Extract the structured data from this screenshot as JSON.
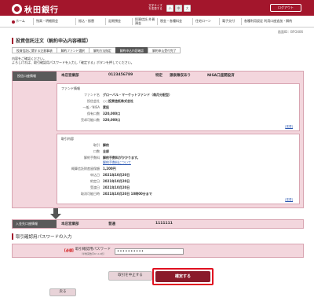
{
  "header": {
    "bank_name": "秋田銀行",
    "textsize_label": "文字サイズを変更する",
    "size_small": "小",
    "size_medium": "中",
    "size_large": "大",
    "logout": "ログアウト"
  },
  "nav": {
    "items": [
      "ホーム",
      "残高・明細照会",
      "振込・振替",
      "定期預金",
      "投資信託 外貨預金",
      "税金・各種料金",
      "住宅ローン",
      "電子交付",
      "各種利用設定 利用口座追加・解約"
    ]
  },
  "screen_id": "画面ID：BFO406",
  "page_title": "投資信託注文（解約申込内容確認）",
  "steps": [
    "投資信託に関する注意事項",
    "解約ファンド選択",
    "解約方法指定",
    "解約申込内容確認",
    "解約申込受付完了"
  ],
  "instructions": [
    "内容をご確認ください。",
    "よろしければ、取引確認用パスワードを入力し「確定する」ボタンを押してください。"
  ],
  "source_account": {
    "label": "投信口座情報",
    "branch": "本店営業部",
    "number": "0123456789",
    "type": "特定",
    "tax": "源泉徴収あり",
    "nisa": "NISA口座開設済"
  },
  "fund": {
    "section": "ファンド情報",
    "rows": [
      {
        "k": "ファンド名",
        "v": "グローバル・マーケットファンド（毎月分配型）"
      },
      {
        "k": "投信会社",
        "v": "○○投資信託株式会社"
      },
      {
        "k": "一般／NISA",
        "v": "累投"
      },
      {
        "k": "保有口数",
        "v": "320,000口"
      },
      {
        "k": "売却可能口数",
        "v": "320,000口"
      }
    ],
    "change": "[変更]"
  },
  "trade": {
    "section": "取引内容",
    "rows": [
      {
        "k": "取引",
        "v": "解約"
      },
      {
        "k": "口数",
        "v": "全部"
      },
      {
        "k": "解約手数料",
        "v": "解約手数料がかかります。"
      },
      {
        "k": "",
        "v": "解約手数料について"
      },
      {
        "k": "概算信託財産留保額",
        "v": "1,200円"
      },
      {
        "k": "申込日",
        "v": "2021年10月20日"
      },
      {
        "k": "約定日",
        "v": "2021年10月20日"
      },
      {
        "k": "受渡日",
        "v": "2021年10月20日"
      },
      {
        "k": "取消可能日時",
        "v": "2021年10月20日 10時00分まで"
      }
    ],
    "change": "[変更]"
  },
  "dest_account": {
    "label": "入金先口座情報",
    "branch": "本店営業部",
    "type": "普通",
    "number": "1111111"
  },
  "password": {
    "title": "取引確認用パスワードの入力",
    "required": "[必須]",
    "label": "取引確認用パスワード",
    "sub": "（半角英数字6～12桁）",
    "value": "••••••••••"
  },
  "buttons": {
    "cancel": "取引を中止する",
    "confirm": "確定する",
    "back": "戻る"
  },
  "colors": {
    "brand": "#a3162c",
    "panel": "#f3d6dd",
    "confirm": "#8a1a2a",
    "highlight": "#e01020"
  }
}
